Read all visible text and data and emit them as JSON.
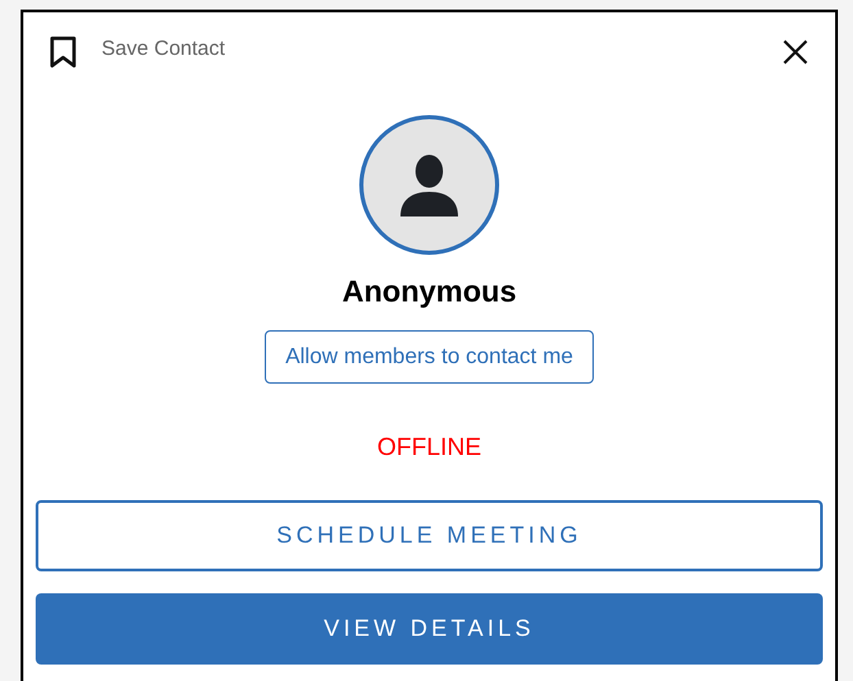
{
  "header": {
    "save_label": "Save Contact"
  },
  "profile": {
    "name": "Anonymous",
    "contact_button": "Allow members to contact me",
    "status": "OFFLINE",
    "online": false
  },
  "buttons": [
    {
      "label": "SCHEDULE MEETING",
      "kind": "outline"
    },
    {
      "label": "VIEW DETAILS",
      "kind": "filled"
    }
  ]
}
